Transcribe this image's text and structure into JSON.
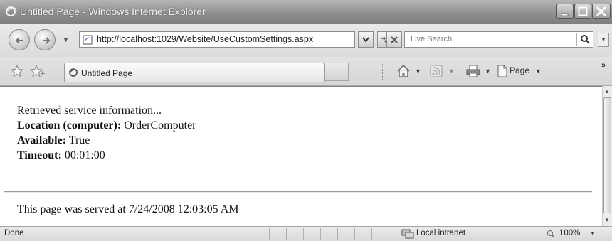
{
  "window": {
    "title": "Untitled Page - Windows Internet Explorer",
    "minimize_icon": "minimize-icon",
    "maximize_icon": "maximize-icon",
    "close_icon": "close-icon"
  },
  "address_bar": {
    "url": "http://localhost:1029/Website/UseCustomSettings.aspx",
    "search_placeholder": "Live Search"
  },
  "tab": {
    "label": "Untitled Page"
  },
  "commands": {
    "page_label": "Page"
  },
  "content": {
    "line1": "Retrieved service information...",
    "location_label": "Location (computer):",
    "location_value": "OrderComputer",
    "available_label": "Available:",
    "available_value": "True",
    "timeout_label": "Timeout:",
    "timeout_value": "00:01:00",
    "served": "This page was served at 7/24/2008 12:03:05 AM"
  },
  "status_bar": {
    "status": "Done",
    "zone": "Local intranet",
    "zoom": "100%"
  }
}
